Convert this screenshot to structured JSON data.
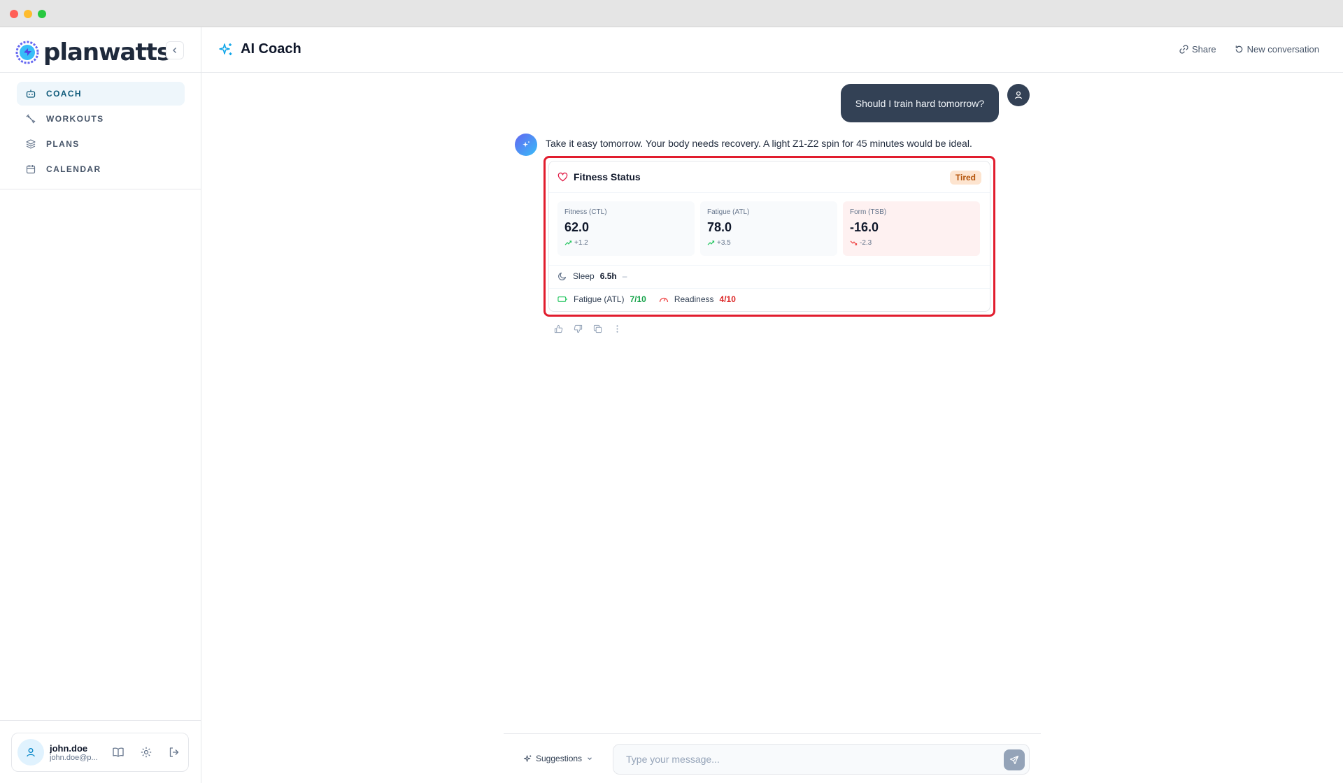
{
  "brand": {
    "name": "planwatts"
  },
  "sidebar": {
    "items": [
      {
        "label": "COACH",
        "icon": "bot-icon",
        "active": true
      },
      {
        "label": "WORKOUTS",
        "icon": "dumbbell-icon",
        "active": false
      },
      {
        "label": "PLANS",
        "icon": "layers-icon",
        "active": false
      },
      {
        "label": "CALENDAR",
        "icon": "calendar-icon",
        "active": false
      }
    ]
  },
  "user": {
    "name": "john.doe",
    "email": "john.doe@p..."
  },
  "header": {
    "title": "AI Coach",
    "share_label": "Share",
    "new_conversation_label": "New conversation"
  },
  "chat": {
    "user_message": "Should I train hard tomorrow?",
    "assistant_message": "Take it easy tomorrow. Your body needs recovery. A light Z1-Z2 spin for 45 minutes would be ideal."
  },
  "fitness_card": {
    "title": "Fitness Status",
    "status_badge": "Tired",
    "metrics": [
      {
        "label": "Fitness (CTL)",
        "value": "62.0",
        "delta": "+1.2",
        "trend": "up"
      },
      {
        "label": "Fatigue (ATL)",
        "value": "78.0",
        "delta": "+3.5",
        "trend": "up"
      },
      {
        "label": "Form (TSB)",
        "value": "-16.0",
        "delta": "-2.3",
        "trend": "down"
      }
    ],
    "sleep": {
      "label": "Sleep",
      "value": "6.5h",
      "trend": "–"
    },
    "fatigue": {
      "label": "Fatigue (ATL)",
      "value": "7/10"
    },
    "readiness": {
      "label": "Readiness",
      "value": "4/10"
    }
  },
  "composer": {
    "suggestions_label": "Suggestions",
    "placeholder": "Type your message..."
  },
  "colors": {
    "accent": "#0e5a7a",
    "user_bubble": "#334155",
    "highlight": "#e11d2e",
    "badge_bg": "#fde4cf",
    "badge_text": "#b45309"
  }
}
